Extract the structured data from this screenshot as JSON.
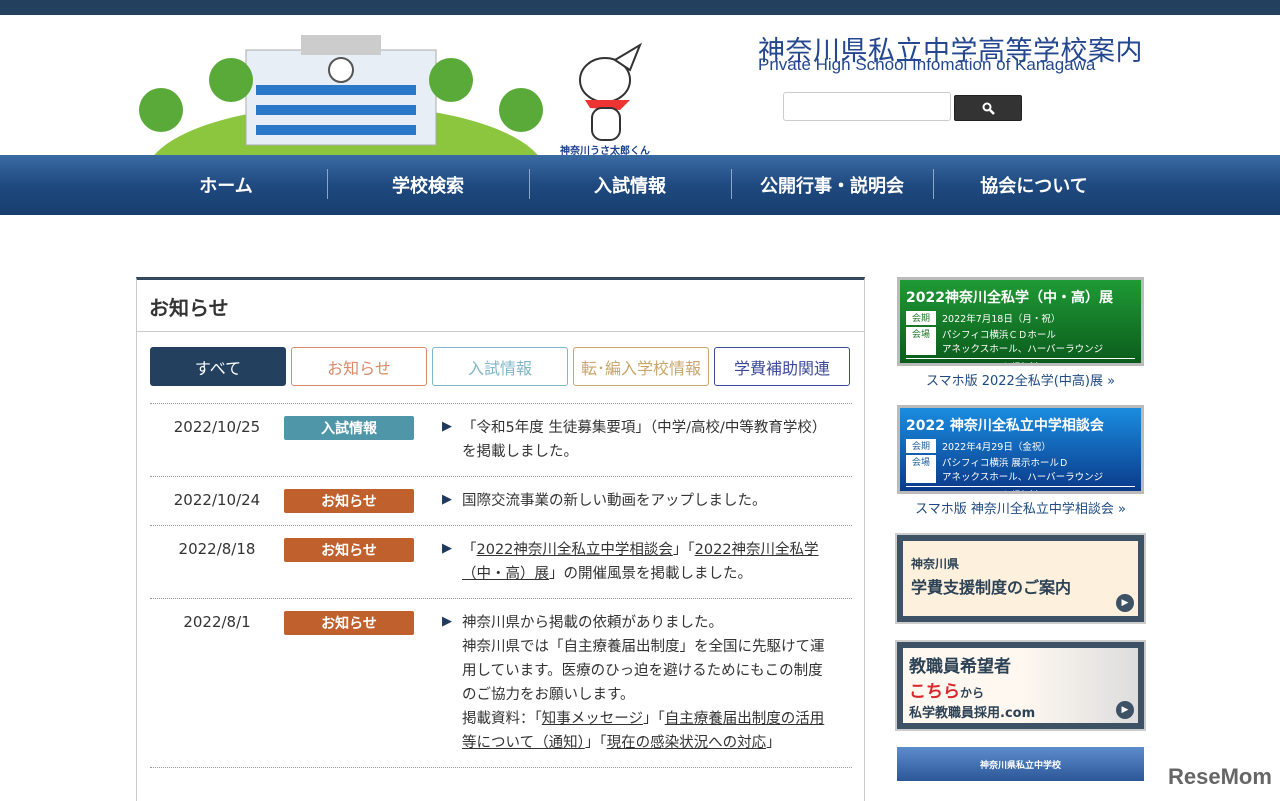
{
  "header": {
    "title": "神奈川県私立中学高等学校案内",
    "subtitle": "Private High School Infomation of Kanagawa",
    "mascot_label": "神奈川うさ太郎くん",
    "search_placeholder": ""
  },
  "nav": [
    "ホーム",
    "学校検索",
    "入試情報",
    "公開行事・説明会",
    "協会について"
  ],
  "news": {
    "title": "お知らせ",
    "tabs": [
      {
        "label": "すべて",
        "color": "#23405f",
        "active": true
      },
      {
        "label": "お知らせ",
        "color": "#d98a6a"
      },
      {
        "label": "入試情報",
        "color": "#7fb6c8"
      },
      {
        "label": "転･編入学校情報",
        "color": "#c9a66b"
      },
      {
        "label": "学費補助関連",
        "color": "#3d4a9a"
      }
    ],
    "items": [
      {
        "date": "2022/10/25",
        "category": "入試情報",
        "color": "#4f97a8",
        "segments": [
          {
            "t": "「令和5年度 生徒募集要項」（中学/高校/中等教育学校）を掲載しました。"
          }
        ]
      },
      {
        "date": "2022/10/24",
        "category": "お知らせ",
        "color": "#c0602c",
        "segments": [
          {
            "t": "国際交流事業の新しい動画をアップしました。"
          }
        ]
      },
      {
        "date": "2022/8/18",
        "category": "お知らせ",
        "color": "#c0602c",
        "segments": [
          {
            "t": "「"
          },
          {
            "t": "2022神奈川全私立中学相談会",
            "link": true
          },
          {
            "t": "」「"
          },
          {
            "t": "2022神奈川全私学（中・高）展",
            "link": true
          },
          {
            "t": "」の開催風景を掲載しました。"
          }
        ]
      },
      {
        "date": "2022/8/1",
        "category": "お知らせ",
        "color": "#c0602c",
        "segments": [
          {
            "t": "神奈川県から掲載の依頼がありました。"
          },
          {
            "br": true
          },
          {
            "t": "神奈川県では「自主療養届出制度」を全国に先駆けて運用しています。医療のひっ迫を避けるためにもこの制度のご協力をお願いします。"
          },
          {
            "br": true
          },
          {
            "t": "掲載資料：「"
          },
          {
            "t": "知事メッセージ",
            "link": true
          },
          {
            "t": "」「"
          },
          {
            "t": "自主療養届出制度の活用等について（通知）",
            "link": true
          },
          {
            "t": "」「"
          },
          {
            "t": "現在の感染状況への対応",
            "link": true
          },
          {
            "t": "」"
          }
        ]
      }
    ]
  },
  "sidebar": {
    "b1": {
      "title": "2022神奈川全私学（中・高）展",
      "period_tag": "会期",
      "period": "2022年7月18日（月・祝）",
      "venue_tag": "会場",
      "venue1": "パシフィコ横浜ＣＤホール",
      "venue2": "アネックスホール、ハーバーラウンジ",
      "free": "入場無料",
      "caption": "スマホ版 2022全私学(中高)展 »"
    },
    "b2": {
      "title": "2022 神奈川全私立中学相談会",
      "period_tag": "会期",
      "period": "2022年4月29日（金祝）",
      "venue_tag": "会場",
      "venue1": "パシフィコ横浜 展示ホールＤ",
      "venue2": "アネックスホール、ハーバーラウンジ",
      "free": "入場無料",
      "caption": "スマホ版 神奈川全私立中学相談会 »"
    },
    "b3": {
      "line1": "神奈川県",
      "line2": "学費支援制度のご案内"
    },
    "b4": {
      "line1": "教職員希望者",
      "line2a": "こちら",
      "line2b": "から",
      "line3": "私学教職員採用.com"
    },
    "b5": {
      "label": "神奈川県私立中学校"
    }
  },
  "watermark": "ReseMom"
}
